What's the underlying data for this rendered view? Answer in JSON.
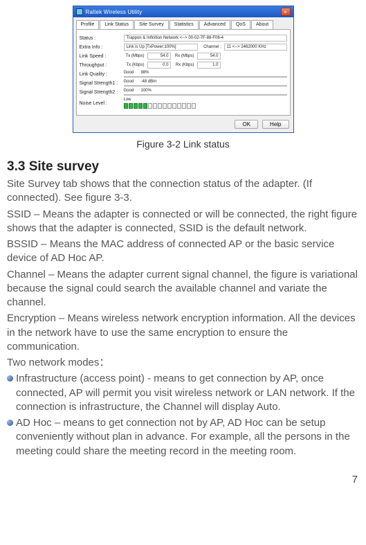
{
  "app": {
    "window_title": "Raltek Wireless Utility",
    "close_glyph": "×",
    "tabs": [
      "Profile",
      "Link Status",
      "Site Survey",
      "Statistics",
      "Advanced",
      "QoS",
      "About"
    ],
    "active_tab_index": 1,
    "fields": {
      "status_label": "Status :",
      "status_value": "Trappon & Infinition Network  <-->  00-02-7F-88-F06-4",
      "extra_label": "Extra Info :",
      "extra_value": "Link is Up [TxPower:100%]",
      "channel_label": "Channel :",
      "channel_value": "11 <--> 2462000 KHz",
      "linkspeed_label": "Link Speed :",
      "tx_label": "Tx (Mbps)",
      "tx_value": "54.0",
      "rx_label": "Rx (Mbps)",
      "rx_value": "54.0",
      "throughput_label": "Throughput :",
      "tp_tx_label": "Tx (Kbps)",
      "tp_tx_value": "0.0",
      "tp_rx_label": "Rx (Kbps)",
      "tp_rx_value": "1.0",
      "quality_label": "Link Quality :",
      "quality_tag": "Good",
      "quality_text": "98%",
      "strength1_label": "Signal Strength1 :",
      "strength1_tag": "Good",
      "strength1_text": "-48 dBm",
      "strength2_label": "Signal Strength2 :",
      "strength2_tag": "Good",
      "strength2_text": "100%",
      "noise_label": "Noise Level :",
      "noise_tag": "Low"
    },
    "buttons": {
      "ok": "OK",
      "help": "Help"
    }
  },
  "figure_caption": "Figure 3-2 Link status",
  "heading": "3.3 Site survey",
  "paragraphs": {
    "p1": "Site Survey tab shows that the connection status of the adapter. (If connected). See figure 3-3.",
    "p2": "SSID – Means the adapter is connected or will be connected, the right figure shows that the adapter is connected, SSID is the default network.",
    "p3": "BSSID – Means the MAC address of connected AP or the basic service device of AD Hoc AP.",
    "p4": "Channel – Means the adapter current signal channel, the figure is variational because the signal could search the available channel and variate the channel.",
    "p5": "Encryption – Means wireless network encryption information. All the devices in the network have to use the same encryption to ensure the communication.",
    "p6": "Two network modes：",
    "b1": "Infrastructure (access point) - means to get connection by AP, once connected, AP will permit you visit wireless network or LAN network. If the connection is infrastructure, the Channel will display Auto.",
    "b2": "AD Hoc – means to get connection not by AP, AD Hoc can be setup conveniently without plan in advance. For example, all the persons in the meeting could share the meeting record in the meeting room."
  },
  "page_number": "7"
}
